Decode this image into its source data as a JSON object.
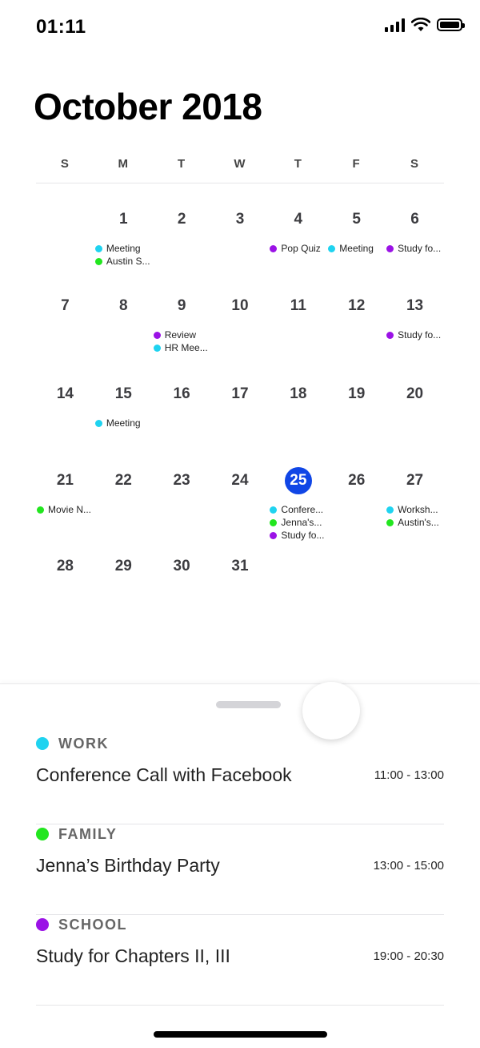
{
  "status_bar": {
    "time": "01:11"
  },
  "calendar": {
    "month_title": "October 2018",
    "weekdays": [
      "S",
      "M",
      "T",
      "W",
      "T",
      "F",
      "S"
    ],
    "today": "25",
    "colors": {
      "work": "#1fd3f0",
      "family": "#22e61f",
      "school": "#9b12e6",
      "today": "#1046e6"
    },
    "days": [
      {
        "n": "1",
        "events": [
          {
            "label": "Meeting",
            "cat": "work"
          },
          {
            "label": "Austin S...",
            "cat": "family"
          }
        ]
      },
      {
        "n": "2",
        "events": []
      },
      {
        "n": "3",
        "events": []
      },
      {
        "n": "4",
        "events": [
          {
            "label": "Pop Quiz",
            "cat": "school"
          }
        ]
      },
      {
        "n": "5",
        "events": [
          {
            "label": "Meeting",
            "cat": "work"
          }
        ]
      },
      {
        "n": "6",
        "events": [
          {
            "label": "Study fo...",
            "cat": "school"
          }
        ]
      },
      {
        "n": "7",
        "events": []
      },
      {
        "n": "8",
        "events": []
      },
      {
        "n": "9",
        "events": [
          {
            "label": "Review",
            "cat": "school"
          },
          {
            "label": "HR Mee...",
            "cat": "work"
          }
        ]
      },
      {
        "n": "10",
        "events": []
      },
      {
        "n": "11",
        "events": []
      },
      {
        "n": "12",
        "events": []
      },
      {
        "n": "13",
        "events": [
          {
            "label": "Study fo...",
            "cat": "school"
          }
        ]
      },
      {
        "n": "14",
        "events": []
      },
      {
        "n": "15",
        "events": [
          {
            "label": "Meeting",
            "cat": "work"
          }
        ]
      },
      {
        "n": "16",
        "events": []
      },
      {
        "n": "17",
        "events": []
      },
      {
        "n": "18",
        "events": []
      },
      {
        "n": "19",
        "events": []
      },
      {
        "n": "20",
        "events": []
      },
      {
        "n": "21",
        "events": [
          {
            "label": "Movie N...",
            "cat": "family"
          }
        ]
      },
      {
        "n": "22",
        "events": []
      },
      {
        "n": "23",
        "events": []
      },
      {
        "n": "24",
        "events": []
      },
      {
        "n": "25",
        "events": [
          {
            "label": "Confere...",
            "cat": "work"
          },
          {
            "label": "Jenna's...",
            "cat": "family"
          },
          {
            "label": "Study fo...",
            "cat": "school"
          }
        ]
      },
      {
        "n": "26",
        "events": []
      },
      {
        "n": "27",
        "events": [
          {
            "label": "Worksh...",
            "cat": "work"
          },
          {
            "label": "Austin's...",
            "cat": "family"
          }
        ]
      },
      {
        "n": "28",
        "events": []
      },
      {
        "n": "29",
        "events": []
      },
      {
        "n": "30",
        "events": []
      },
      {
        "n": "31",
        "events": []
      }
    ]
  },
  "agenda": {
    "items": [
      {
        "category": "WORK",
        "cat": "work",
        "title": "Conference Call with Facebook",
        "time": "11:00 - 13:00"
      },
      {
        "category": "FAMILY",
        "cat": "family",
        "title": "Jenna’s Birthday Party",
        "time": "13:00 - 15:00"
      },
      {
        "category": "SCHOOL",
        "cat": "school",
        "title": "Study for Chapters II, III",
        "time": "19:00 - 20:30"
      }
    ]
  }
}
